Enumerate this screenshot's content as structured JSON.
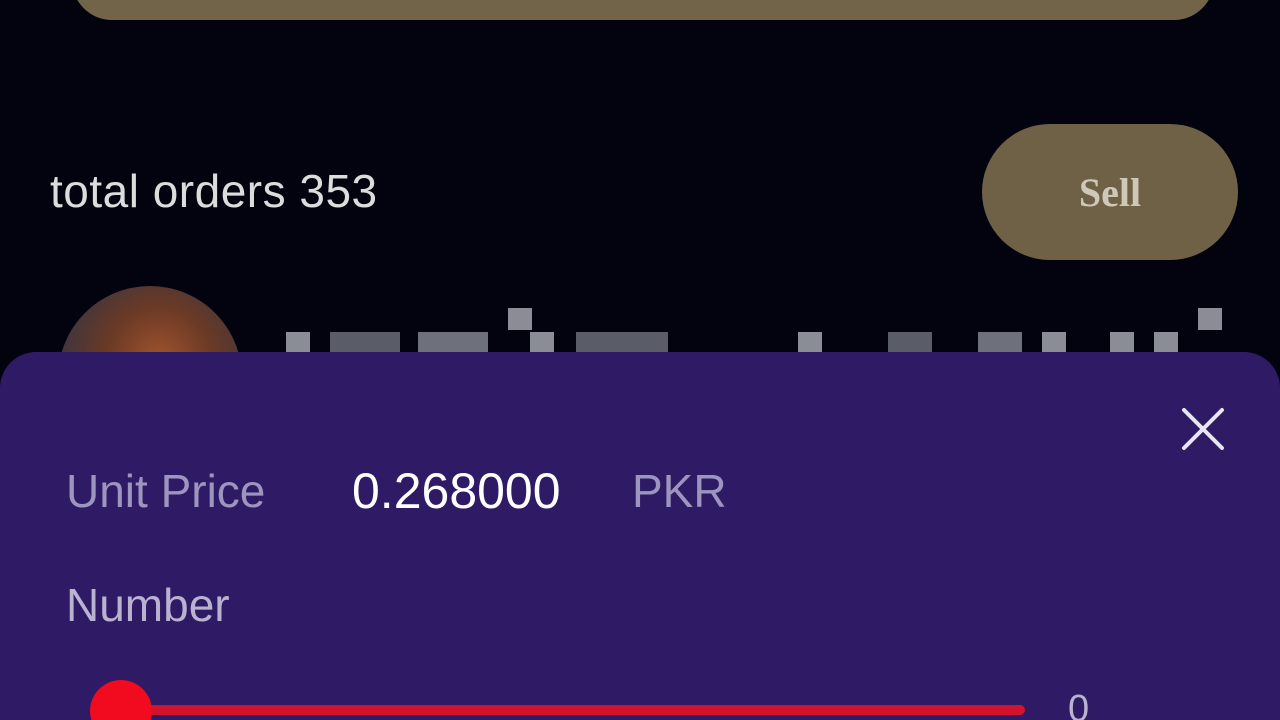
{
  "order_summary": {
    "total_orders_text": "total orders 353",
    "sell_label": "Sell"
  },
  "purchase_sheet": {
    "unit_price_label": "Unit Price",
    "unit_price_value": "0.268000",
    "currency": "PKR",
    "number_label": "Number",
    "slider_value": "0"
  },
  "colors": {
    "background": "#02030f",
    "sell_button": "#6f6146",
    "sheet_background": "#2f1a66",
    "slider_accent": "#f20a1e"
  },
  "icons": {
    "close": "close-icon"
  }
}
